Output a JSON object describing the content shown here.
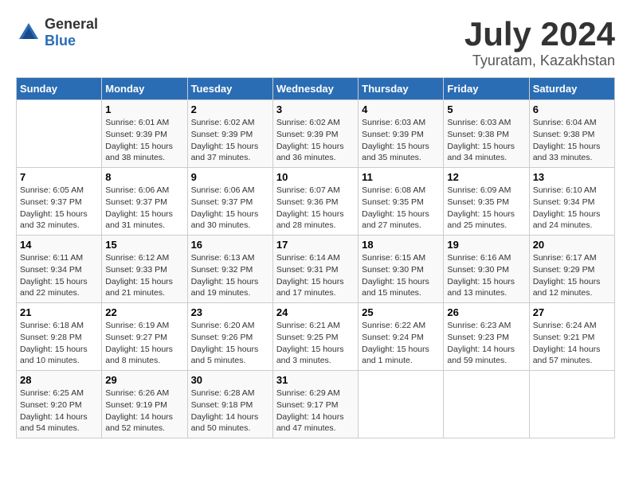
{
  "logo": {
    "text_general": "General",
    "text_blue": "Blue"
  },
  "header": {
    "month_year": "July 2024",
    "location": "Tyuratam, Kazakhstan"
  },
  "weekdays": [
    "Sunday",
    "Monday",
    "Tuesday",
    "Wednesday",
    "Thursday",
    "Friday",
    "Saturday"
  ],
  "weeks": [
    [
      {
        "day": "",
        "sunrise": "",
        "sunset": "",
        "daylight": ""
      },
      {
        "day": "1",
        "sunrise": "Sunrise: 6:01 AM",
        "sunset": "Sunset: 9:39 PM",
        "daylight": "Daylight: 15 hours and 38 minutes."
      },
      {
        "day": "2",
        "sunrise": "Sunrise: 6:02 AM",
        "sunset": "Sunset: 9:39 PM",
        "daylight": "Daylight: 15 hours and 37 minutes."
      },
      {
        "day": "3",
        "sunrise": "Sunrise: 6:02 AM",
        "sunset": "Sunset: 9:39 PM",
        "daylight": "Daylight: 15 hours and 36 minutes."
      },
      {
        "day": "4",
        "sunrise": "Sunrise: 6:03 AM",
        "sunset": "Sunset: 9:39 PM",
        "daylight": "Daylight: 15 hours and 35 minutes."
      },
      {
        "day": "5",
        "sunrise": "Sunrise: 6:03 AM",
        "sunset": "Sunset: 9:38 PM",
        "daylight": "Daylight: 15 hours and 34 minutes."
      },
      {
        "day": "6",
        "sunrise": "Sunrise: 6:04 AM",
        "sunset": "Sunset: 9:38 PM",
        "daylight": "Daylight: 15 hours and 33 minutes."
      }
    ],
    [
      {
        "day": "7",
        "sunrise": "Sunrise: 6:05 AM",
        "sunset": "Sunset: 9:37 PM",
        "daylight": "Daylight: 15 hours and 32 minutes."
      },
      {
        "day": "8",
        "sunrise": "Sunrise: 6:06 AM",
        "sunset": "Sunset: 9:37 PM",
        "daylight": "Daylight: 15 hours and 31 minutes."
      },
      {
        "day": "9",
        "sunrise": "Sunrise: 6:06 AM",
        "sunset": "Sunset: 9:37 PM",
        "daylight": "Daylight: 15 hours and 30 minutes."
      },
      {
        "day": "10",
        "sunrise": "Sunrise: 6:07 AM",
        "sunset": "Sunset: 9:36 PM",
        "daylight": "Daylight: 15 hours and 28 minutes."
      },
      {
        "day": "11",
        "sunrise": "Sunrise: 6:08 AM",
        "sunset": "Sunset: 9:35 PM",
        "daylight": "Daylight: 15 hours and 27 minutes."
      },
      {
        "day": "12",
        "sunrise": "Sunrise: 6:09 AM",
        "sunset": "Sunset: 9:35 PM",
        "daylight": "Daylight: 15 hours and 25 minutes."
      },
      {
        "day": "13",
        "sunrise": "Sunrise: 6:10 AM",
        "sunset": "Sunset: 9:34 PM",
        "daylight": "Daylight: 15 hours and 24 minutes."
      }
    ],
    [
      {
        "day": "14",
        "sunrise": "Sunrise: 6:11 AM",
        "sunset": "Sunset: 9:34 PM",
        "daylight": "Daylight: 15 hours and 22 minutes."
      },
      {
        "day": "15",
        "sunrise": "Sunrise: 6:12 AM",
        "sunset": "Sunset: 9:33 PM",
        "daylight": "Daylight: 15 hours and 21 minutes."
      },
      {
        "day": "16",
        "sunrise": "Sunrise: 6:13 AM",
        "sunset": "Sunset: 9:32 PM",
        "daylight": "Daylight: 15 hours and 19 minutes."
      },
      {
        "day": "17",
        "sunrise": "Sunrise: 6:14 AM",
        "sunset": "Sunset: 9:31 PM",
        "daylight": "Daylight: 15 hours and 17 minutes."
      },
      {
        "day": "18",
        "sunrise": "Sunrise: 6:15 AM",
        "sunset": "Sunset: 9:30 PM",
        "daylight": "Daylight: 15 hours and 15 minutes."
      },
      {
        "day": "19",
        "sunrise": "Sunrise: 6:16 AM",
        "sunset": "Sunset: 9:30 PM",
        "daylight": "Daylight: 15 hours and 13 minutes."
      },
      {
        "day": "20",
        "sunrise": "Sunrise: 6:17 AM",
        "sunset": "Sunset: 9:29 PM",
        "daylight": "Daylight: 15 hours and 12 minutes."
      }
    ],
    [
      {
        "day": "21",
        "sunrise": "Sunrise: 6:18 AM",
        "sunset": "Sunset: 9:28 PM",
        "daylight": "Daylight: 15 hours and 10 minutes."
      },
      {
        "day": "22",
        "sunrise": "Sunrise: 6:19 AM",
        "sunset": "Sunset: 9:27 PM",
        "daylight": "Daylight: 15 hours and 8 minutes."
      },
      {
        "day": "23",
        "sunrise": "Sunrise: 6:20 AM",
        "sunset": "Sunset: 9:26 PM",
        "daylight": "Daylight: 15 hours and 5 minutes."
      },
      {
        "day": "24",
        "sunrise": "Sunrise: 6:21 AM",
        "sunset": "Sunset: 9:25 PM",
        "daylight": "Daylight: 15 hours and 3 minutes."
      },
      {
        "day": "25",
        "sunrise": "Sunrise: 6:22 AM",
        "sunset": "Sunset: 9:24 PM",
        "daylight": "Daylight: 15 hours and 1 minute."
      },
      {
        "day": "26",
        "sunrise": "Sunrise: 6:23 AM",
        "sunset": "Sunset: 9:23 PM",
        "daylight": "Daylight: 14 hours and 59 minutes."
      },
      {
        "day": "27",
        "sunrise": "Sunrise: 6:24 AM",
        "sunset": "Sunset: 9:21 PM",
        "daylight": "Daylight: 14 hours and 57 minutes."
      }
    ],
    [
      {
        "day": "28",
        "sunrise": "Sunrise: 6:25 AM",
        "sunset": "Sunset: 9:20 PM",
        "daylight": "Daylight: 14 hours and 54 minutes."
      },
      {
        "day": "29",
        "sunrise": "Sunrise: 6:26 AM",
        "sunset": "Sunset: 9:19 PM",
        "daylight": "Daylight: 14 hours and 52 minutes."
      },
      {
        "day": "30",
        "sunrise": "Sunrise: 6:28 AM",
        "sunset": "Sunset: 9:18 PM",
        "daylight": "Daylight: 14 hours and 50 minutes."
      },
      {
        "day": "31",
        "sunrise": "Sunrise: 6:29 AM",
        "sunset": "Sunset: 9:17 PM",
        "daylight": "Daylight: 14 hours and 47 minutes."
      },
      {
        "day": "",
        "sunrise": "",
        "sunset": "",
        "daylight": ""
      },
      {
        "day": "",
        "sunrise": "",
        "sunset": "",
        "daylight": ""
      },
      {
        "day": "",
        "sunrise": "",
        "sunset": "",
        "daylight": ""
      }
    ]
  ]
}
